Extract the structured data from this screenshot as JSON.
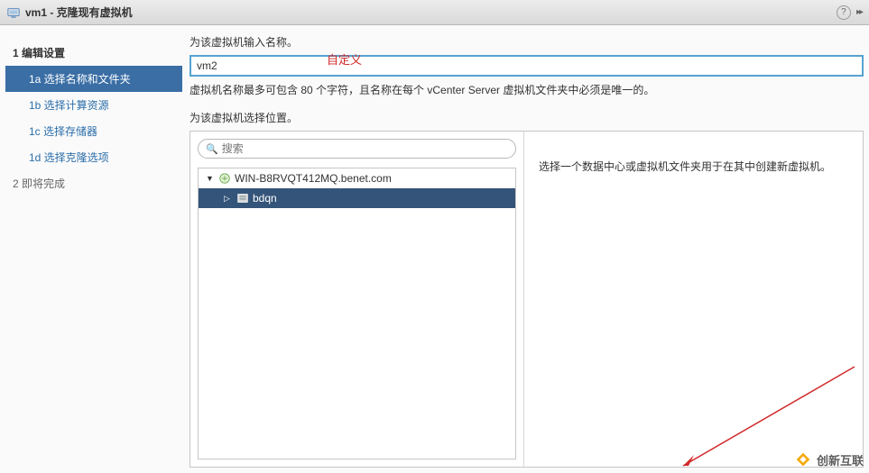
{
  "titlebar": {
    "title": "vm1 - 克隆现有虚拟机",
    "help": "?",
    "expand": "▸▸"
  },
  "sidebar": {
    "step1_label": "1 编辑设置",
    "items": [
      {
        "id": "1a",
        "label": "1a 选择名称和文件夹"
      },
      {
        "id": "1b",
        "label": "1b 选择计算资源"
      },
      {
        "id": "1c",
        "label": "1c 选择存储器"
      },
      {
        "id": "1d",
        "label": "1d 选择克隆选项"
      }
    ],
    "step2_label": "2 即将完成"
  },
  "main": {
    "name_label": "为该虚拟机输入名称。",
    "name_value": "vm2",
    "annotation": "自定义",
    "name_hint": "虚拟机名称最多可包含 80 个字符，且名称在每个 vCenter Server 虚拟机文件夹中必须是唯一的。",
    "loc_label": "为该虚拟机选择位置。",
    "search_placeholder": "搜索",
    "tree": {
      "root": "WIN-B8RVQT412MQ.benet.com",
      "child": "bdqn"
    },
    "desc": "选择一个数据中心或虚拟机文件夹用于在其中创建新虚拟机。"
  },
  "watermark": "创新互联"
}
